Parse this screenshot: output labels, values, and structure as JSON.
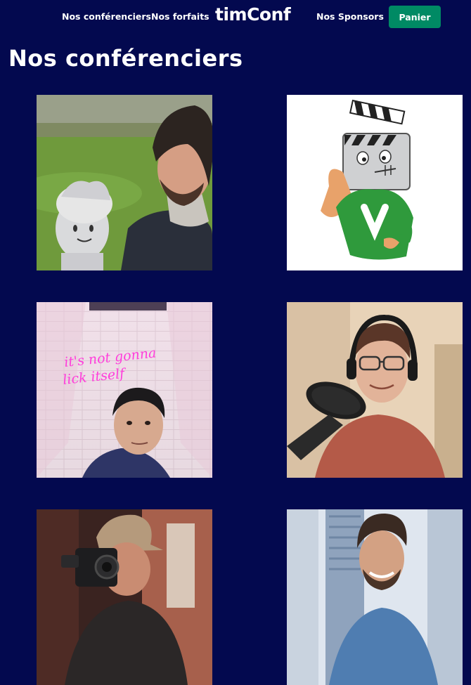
{
  "nav": {
    "speakers_link": "Nos conférenciers",
    "plans_link": "Nos forfaits",
    "brand": "timConf",
    "sponsors_link": "Nos Sponsors",
    "cart_button": "Panier"
  },
  "page": {
    "title": "Nos conférenciers"
  },
  "speakers": [
    {
      "photo": "photo-man-with-plush"
    },
    {
      "photo": "photo-clapperboard-mascot"
    },
    {
      "photo": "photo-man-under-neon-sign",
      "neon_line1": "it's not gonna",
      "neon_line2": "lick itself"
    },
    {
      "photo": "photo-man-with-microphone"
    },
    {
      "photo": "photo-man-with-camera"
    },
    {
      "photo": "photo-man-smiling-outdoors"
    }
  ],
  "colors": {
    "background": "#03094f",
    "cart_button": "#008a64",
    "text": "#ffffff"
  }
}
